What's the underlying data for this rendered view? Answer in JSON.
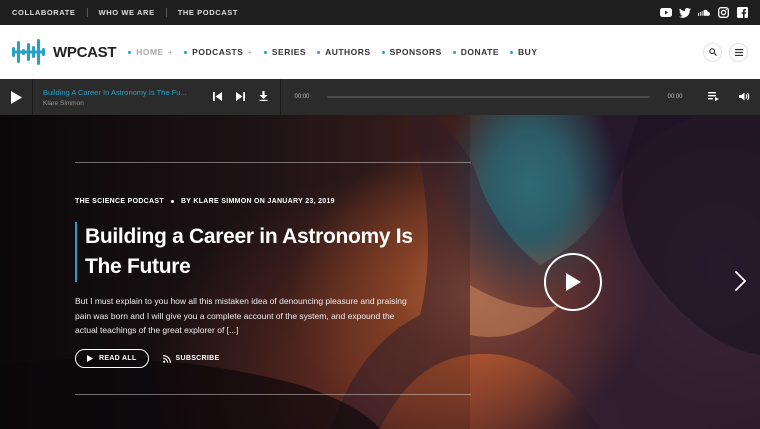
{
  "topbar": {
    "links": [
      "COLLABORATE",
      "WHO WE ARE",
      "THE PODCAST"
    ],
    "social": [
      "youtube-icon",
      "twitter-icon",
      "soundcloud-icon",
      "instagram-icon",
      "facebook-icon"
    ]
  },
  "header": {
    "logo_text": "WPCAST",
    "nav": [
      {
        "label": "HOME",
        "has_plus": true,
        "active": true
      },
      {
        "label": "PODCASTS",
        "has_plus": true
      },
      {
        "label": "SERIES"
      },
      {
        "label": "AUTHORS"
      },
      {
        "label": "SPONSORS"
      },
      {
        "label": "DONATE"
      },
      {
        "label": "BUY"
      }
    ],
    "plus": "+",
    "accent": "#27a0c6"
  },
  "player": {
    "track_title": "Building A Career In Astronomy Is The Fu...",
    "track_author": "Klare Simmon",
    "time_current": "00:00",
    "time_total": "00:00",
    "progress": 0
  },
  "hero": {
    "category": "THE SCIENCE PODCAST",
    "byline": "BY KLARE SIMMON ON JANUARY 23, 2019",
    "title_line1": "Building a Career in Astronomy Is",
    "title_line2": "The Future",
    "excerpt": "But I must explain to you how all this mistaken idea of denouncing pleasure and praising pain was born and I will give you a complete account of the system, and expound the actual teachings of the great explorer of [...]",
    "read_all": "READ ALL",
    "subscribe": "SUBSCRIBE"
  }
}
